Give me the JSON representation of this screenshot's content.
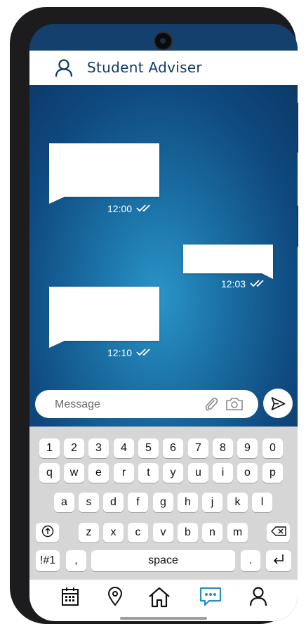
{
  "header": {
    "title": "Student Adviser",
    "avatar_icon": "user-icon"
  },
  "messages": [
    {
      "direction": "incoming",
      "time": "12:00",
      "status_icon": "double-check-icon"
    },
    {
      "direction": "outgoing",
      "time": "12:03",
      "status_icon": "double-check-icon"
    },
    {
      "direction": "incoming",
      "time": "12:10",
      "status_icon": "double-check-icon"
    }
  ],
  "composer": {
    "placeholder": "Message",
    "attach_icon": "paperclip-icon",
    "camera_icon": "camera-icon",
    "send_icon": "send-icon"
  },
  "keyboard": {
    "row1": [
      "1",
      "2",
      "3",
      "4",
      "5",
      "6",
      "7",
      "8",
      "9",
      "0"
    ],
    "row2": [
      "q",
      "w",
      "e",
      "r",
      "t",
      "y",
      "u",
      "i",
      "o",
      "p"
    ],
    "row3": [
      "a",
      "s",
      "d",
      "f",
      "g",
      "h",
      "j",
      "k",
      "l"
    ],
    "row4": [
      "z",
      "x",
      "c",
      "v",
      "b",
      "n",
      "m"
    ],
    "shift_icon": "shift-icon",
    "backspace_icon": "backspace-icon",
    "symbols": "!#1",
    "comma": ",",
    "space": "space",
    "period": ".",
    "enter_icon": "enter-icon"
  },
  "nav": {
    "items": [
      {
        "icon": "calendar-icon",
        "active": false
      },
      {
        "icon": "location-pin-icon",
        "active": false
      },
      {
        "icon": "home-icon",
        "active": false
      },
      {
        "icon": "chat-icon",
        "active": true
      },
      {
        "icon": "profile-icon",
        "active": false
      }
    ],
    "active_color": "#2a8fc0",
    "inactive_color": "#111111"
  },
  "colors": {
    "brand": "#0f3a66",
    "chat_glow": "#2a95c8"
  }
}
